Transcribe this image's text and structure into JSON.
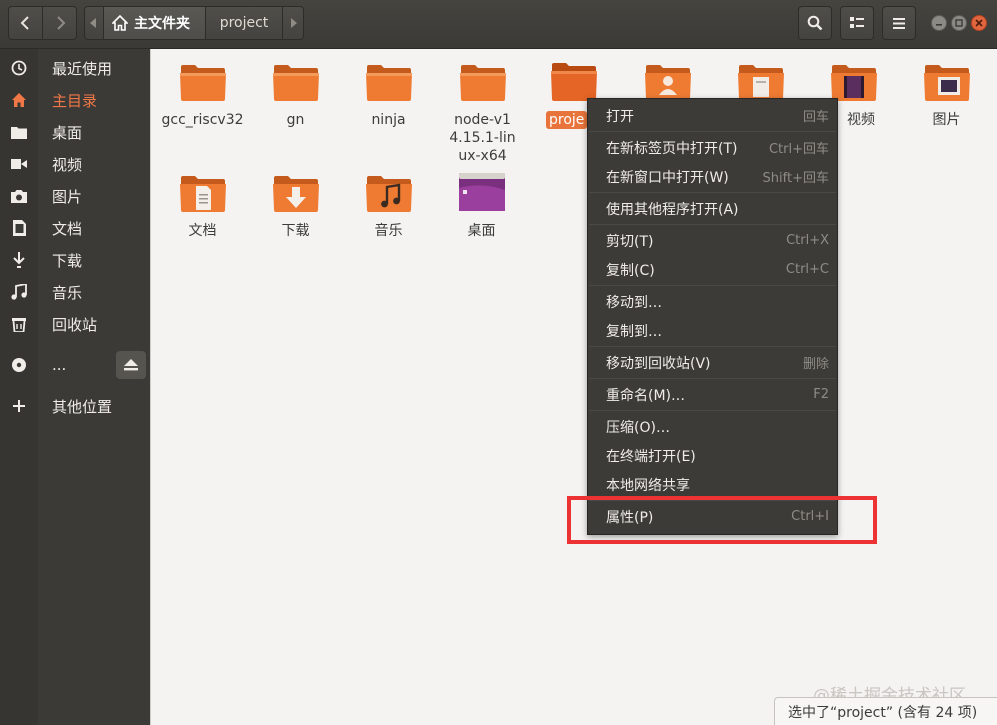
{
  "header": {
    "breadcrumbs": [
      "主文件夹",
      "project"
    ]
  },
  "sidebar": {
    "items": [
      {
        "label": "最近使用",
        "icon": "recent-icon"
      },
      {
        "label": "主目录",
        "icon": "home-icon",
        "active": true
      },
      {
        "label": "桌面",
        "icon": "folder-icon"
      },
      {
        "label": "视频",
        "icon": "video-icon"
      },
      {
        "label": "图片",
        "icon": "camera-icon"
      },
      {
        "label": "文档",
        "icon": "document-icon"
      },
      {
        "label": "下载",
        "icon": "download-icon"
      },
      {
        "label": "音乐",
        "icon": "music-icon"
      },
      {
        "label": "回收站",
        "icon": "trash-icon"
      },
      {
        "label": "...",
        "icon": "disc-icon"
      },
      {
        "label": "其他位置",
        "icon": "plus-icon"
      }
    ]
  },
  "files": [
    {
      "name": "gcc_riscv32",
      "icon": "folder-icon"
    },
    {
      "name": "gn",
      "icon": "folder-icon"
    },
    {
      "name": "ninja",
      "icon": "folder-icon"
    },
    {
      "name": "node-v14.15.1-linux-x64",
      "icon": "folder-icon"
    },
    {
      "name": "proje",
      "icon": "project-folder-icon",
      "selected": true
    },
    {
      "name": "",
      "icon": "folder-user-icon"
    },
    {
      "name": "",
      "icon": "folder-template-icon"
    },
    {
      "name": "视频",
      "icon": "folder-video-icon"
    },
    {
      "name": "图片",
      "icon": "folder-pictures-icon"
    },
    {
      "name": "文档",
      "icon": "folder-documents-icon"
    },
    {
      "name": "下载",
      "icon": "folder-download-icon"
    },
    {
      "name": "音乐",
      "icon": "folder-music-icon"
    },
    {
      "name": "桌面",
      "icon": "folder-desktop-icon"
    }
  ],
  "context_menu": {
    "items": [
      {
        "label": "打开",
        "accel": "回车"
      },
      {
        "label": "在新标签页中打开(T)",
        "accel": "Ctrl+回车"
      },
      {
        "label": "在新窗口中打开(W)",
        "accel": "Shift+回车"
      },
      {
        "label": "使用其他程序打开(A)",
        "accel": ""
      },
      {
        "label": "剪切(T)",
        "accel": "Ctrl+X"
      },
      {
        "label": "复制(C)",
        "accel": "Ctrl+C"
      },
      {
        "label": "移动到…",
        "accel": ""
      },
      {
        "label": "复制到…",
        "accel": ""
      },
      {
        "label": "移动到回收站(V)",
        "accel": "删除"
      },
      {
        "label": "重命名(M)…",
        "accel": "F2"
      },
      {
        "label": "压缩(O)…",
        "accel": ""
      },
      {
        "label": "在终端打开(E)",
        "accel": ""
      },
      {
        "label": "本地网络共享",
        "accel": ""
      },
      {
        "label": "属性(P)",
        "accel": "Ctrl+I"
      }
    ]
  },
  "status": {
    "text": "选中了“project” (含有 24 项)"
  },
  "watermark": "@稀土掘金技术社区",
  "colors": {
    "accent": "#e8743b",
    "highlight_box": "#ec3232",
    "sidebar_bg": "#3b3a37",
    "menu_bg": "#3c3b37"
  }
}
